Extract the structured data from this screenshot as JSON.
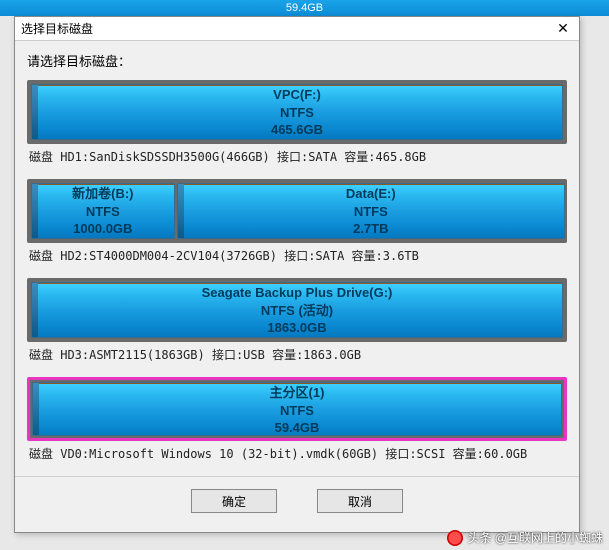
{
  "topbar_text": "59.4GB",
  "dialog": {
    "title": "选择目标磁盘",
    "prompt": "请选择目标磁盘："
  },
  "disks": [
    {
      "partitions": [
        {
          "width_pct": 100,
          "name": "VPC(F:)",
          "fs": "NTFS",
          "size": "465.6GB"
        }
      ],
      "info": "磁盘 HD1:SanDiskSDSSDH3500G(466GB)  接口:SATA  容量:465.8GB"
    },
    {
      "partitions": [
        {
          "width_pct": 27,
          "name": "新加卷(B:)",
          "fs": "NTFS",
          "size": "1000.0GB"
        },
        {
          "width_pct": 73,
          "name": "Data(E:)",
          "fs": "NTFS",
          "size": "2.7TB"
        }
      ],
      "info": "磁盘 HD2:ST4000DM004-2CV104(3726GB)  接口:SATA  容量:3.6TB"
    },
    {
      "partitions": [
        {
          "width_pct": 100,
          "name": "Seagate Backup Plus Drive(G:)",
          "fs": "NTFS (活动)",
          "size": "1863.0GB"
        }
      ],
      "info": "磁盘 HD3:ASMT2115(1863GB)  接口:USB  容量:1863.0GB"
    },
    {
      "selected": true,
      "partitions": [
        {
          "width_pct": 100,
          "name": "主分区(1)",
          "fs": "NTFS",
          "size": "59.4GB"
        }
      ],
      "info": "磁盘 VD0:Microsoft Windows 10 (32-bit).vmdk(60GB)  接口:SCSI  容量:60.0GB"
    }
  ],
  "buttons": {
    "ok": "确定",
    "cancel": "取消"
  },
  "watermark": "头条 @互联网上的小蜘蛛"
}
